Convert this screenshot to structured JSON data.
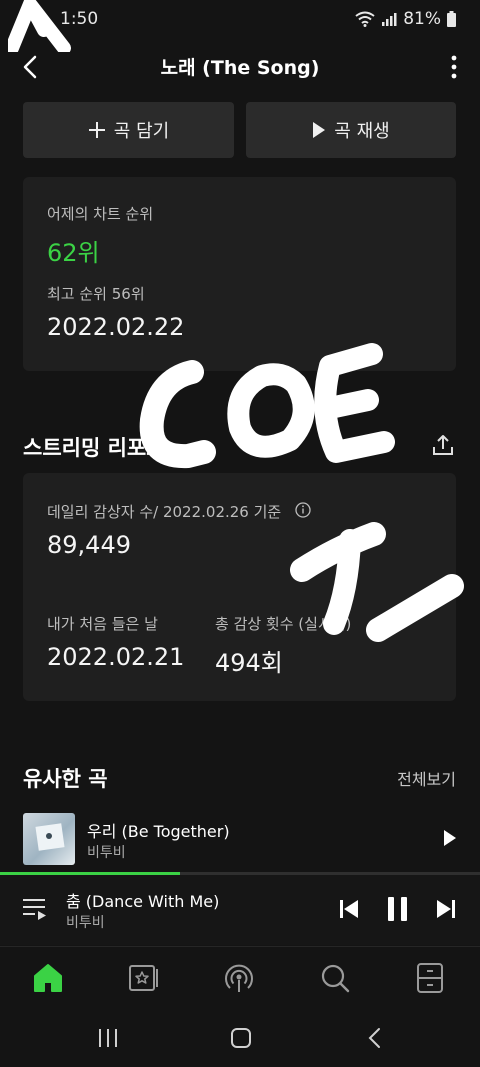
{
  "status_bar": {
    "time": "1:50",
    "battery": "81%"
  },
  "header": {
    "title": "노래 (The Song)"
  },
  "actions": {
    "add_label": "곡 담기",
    "play_label": "곡 재생"
  },
  "chart_card": {
    "yesterday_label": "어제의 차트 순위",
    "yesterday_rank": "62위",
    "best_label": "최고 순위 56위",
    "best_date": "2022.02.22"
  },
  "streaming": {
    "section_title": "스트리밍 리포트",
    "daily_label": "데일리 감상자 수/ 2022.02.26 기준",
    "daily_value": "89,449",
    "first_label": "내가 처음 들은 날",
    "first_value": "2022.02.21",
    "total_label": "총 감상 횟수 (실시간)",
    "total_value": "494회"
  },
  "similar": {
    "section_title": "유사한 곡",
    "see_all": "전체보기",
    "songs": [
      {
        "title": "우리 (Be Together)",
        "artist": "비투비"
      }
    ]
  },
  "now_playing": {
    "title": "춤 (Dance With Me)",
    "artist": "비투비",
    "progress": 0.375
  },
  "bottom_nav": [
    "home-icon",
    "library-icon",
    "podcast-icon",
    "search-icon",
    "storage-icon"
  ],
  "colors": {
    "accent": "#3bd245",
    "background": "#141414",
    "card": "#1f1f1f"
  }
}
